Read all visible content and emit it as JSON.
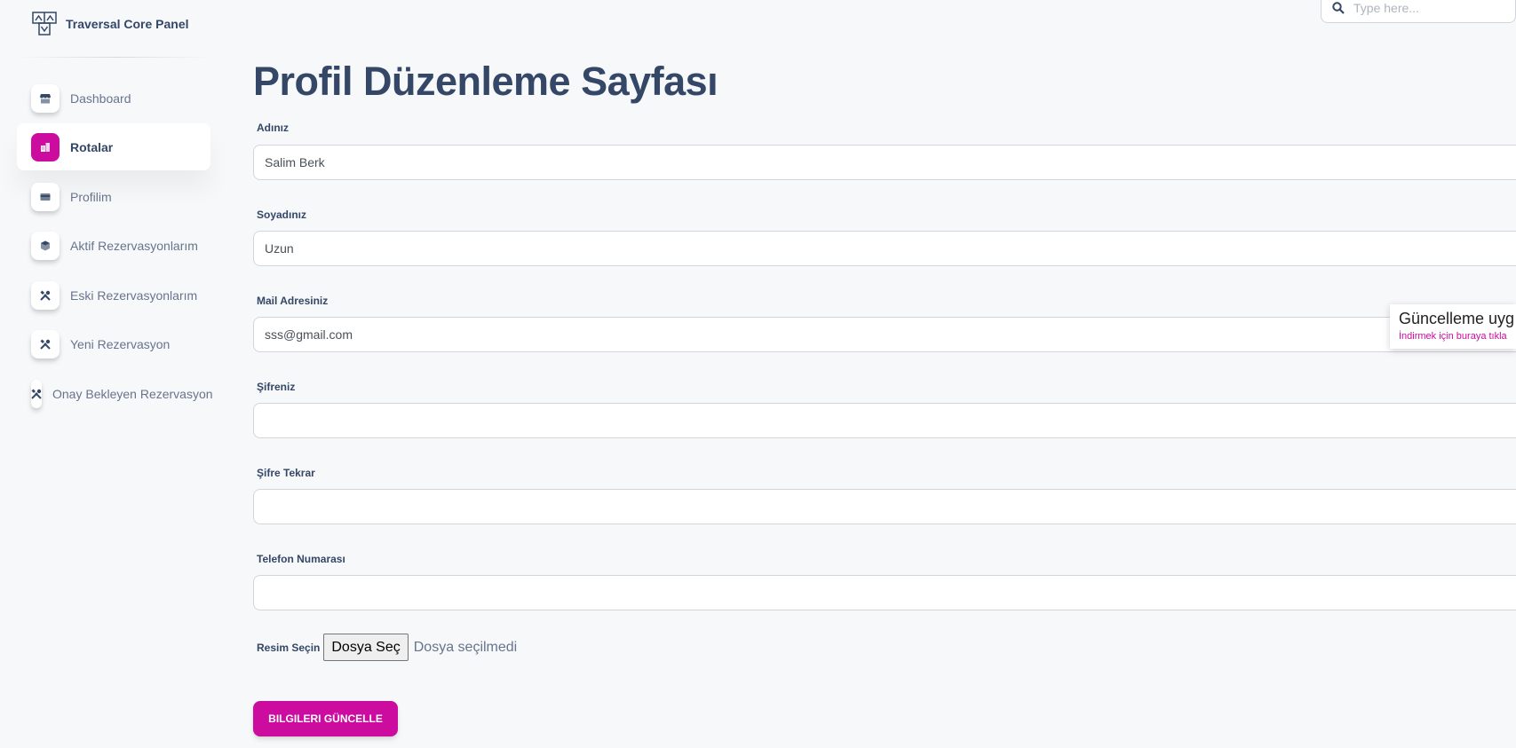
{
  "app": {
    "title": "Traversal Core Panel"
  },
  "search": {
    "placeholder": "Type here..."
  },
  "sidebar": {
    "items": [
      {
        "label": "Dashboard",
        "icon": "shop-icon",
        "active": false
      },
      {
        "label": "Rotalar",
        "icon": "office-icon",
        "active": true
      },
      {
        "label": "Profilim",
        "icon": "credit-card-icon",
        "active": false
      },
      {
        "label": "Aktif Rezervasyonlarım",
        "icon": "box-icon",
        "active": false
      },
      {
        "label": "Eski Rezervasyonlarım",
        "icon": "tools-icon",
        "active": false
      },
      {
        "label": "Yeni Rezervasyon",
        "icon": "tools-icon",
        "active": false
      },
      {
        "label": "Onay Bekleyen Rezervasyon",
        "icon": "tools-icon",
        "active": false
      }
    ]
  },
  "main": {
    "title": "Profil Düzenleme Sayfası",
    "fields": [
      {
        "label": "Adınız",
        "value": "Salim Berk"
      },
      {
        "label": "Soyadınız",
        "value": "Uzun"
      },
      {
        "label": "Mail Adresiniz",
        "value": "sss@gmail.com"
      },
      {
        "label": "Şifreniz",
        "value": ""
      },
      {
        "label": "Şifre Tekrar",
        "value": ""
      },
      {
        "label": "Telefon Numarası",
        "value": ""
      }
    ],
    "file": {
      "label": "Resim Seçin",
      "button": "Dosya Seç",
      "status": "Dosya seçilmedi"
    },
    "submit_label": "BILGILERI GÜNCELLE"
  },
  "toast": {
    "title": "Güncelleme uyg",
    "subtitle": "İndirmek için buraya tıkla"
  },
  "colors": {
    "accent": "#cb0c9f",
    "text": "#344767",
    "muted": "#67748e",
    "background": "#f7f8fa"
  }
}
